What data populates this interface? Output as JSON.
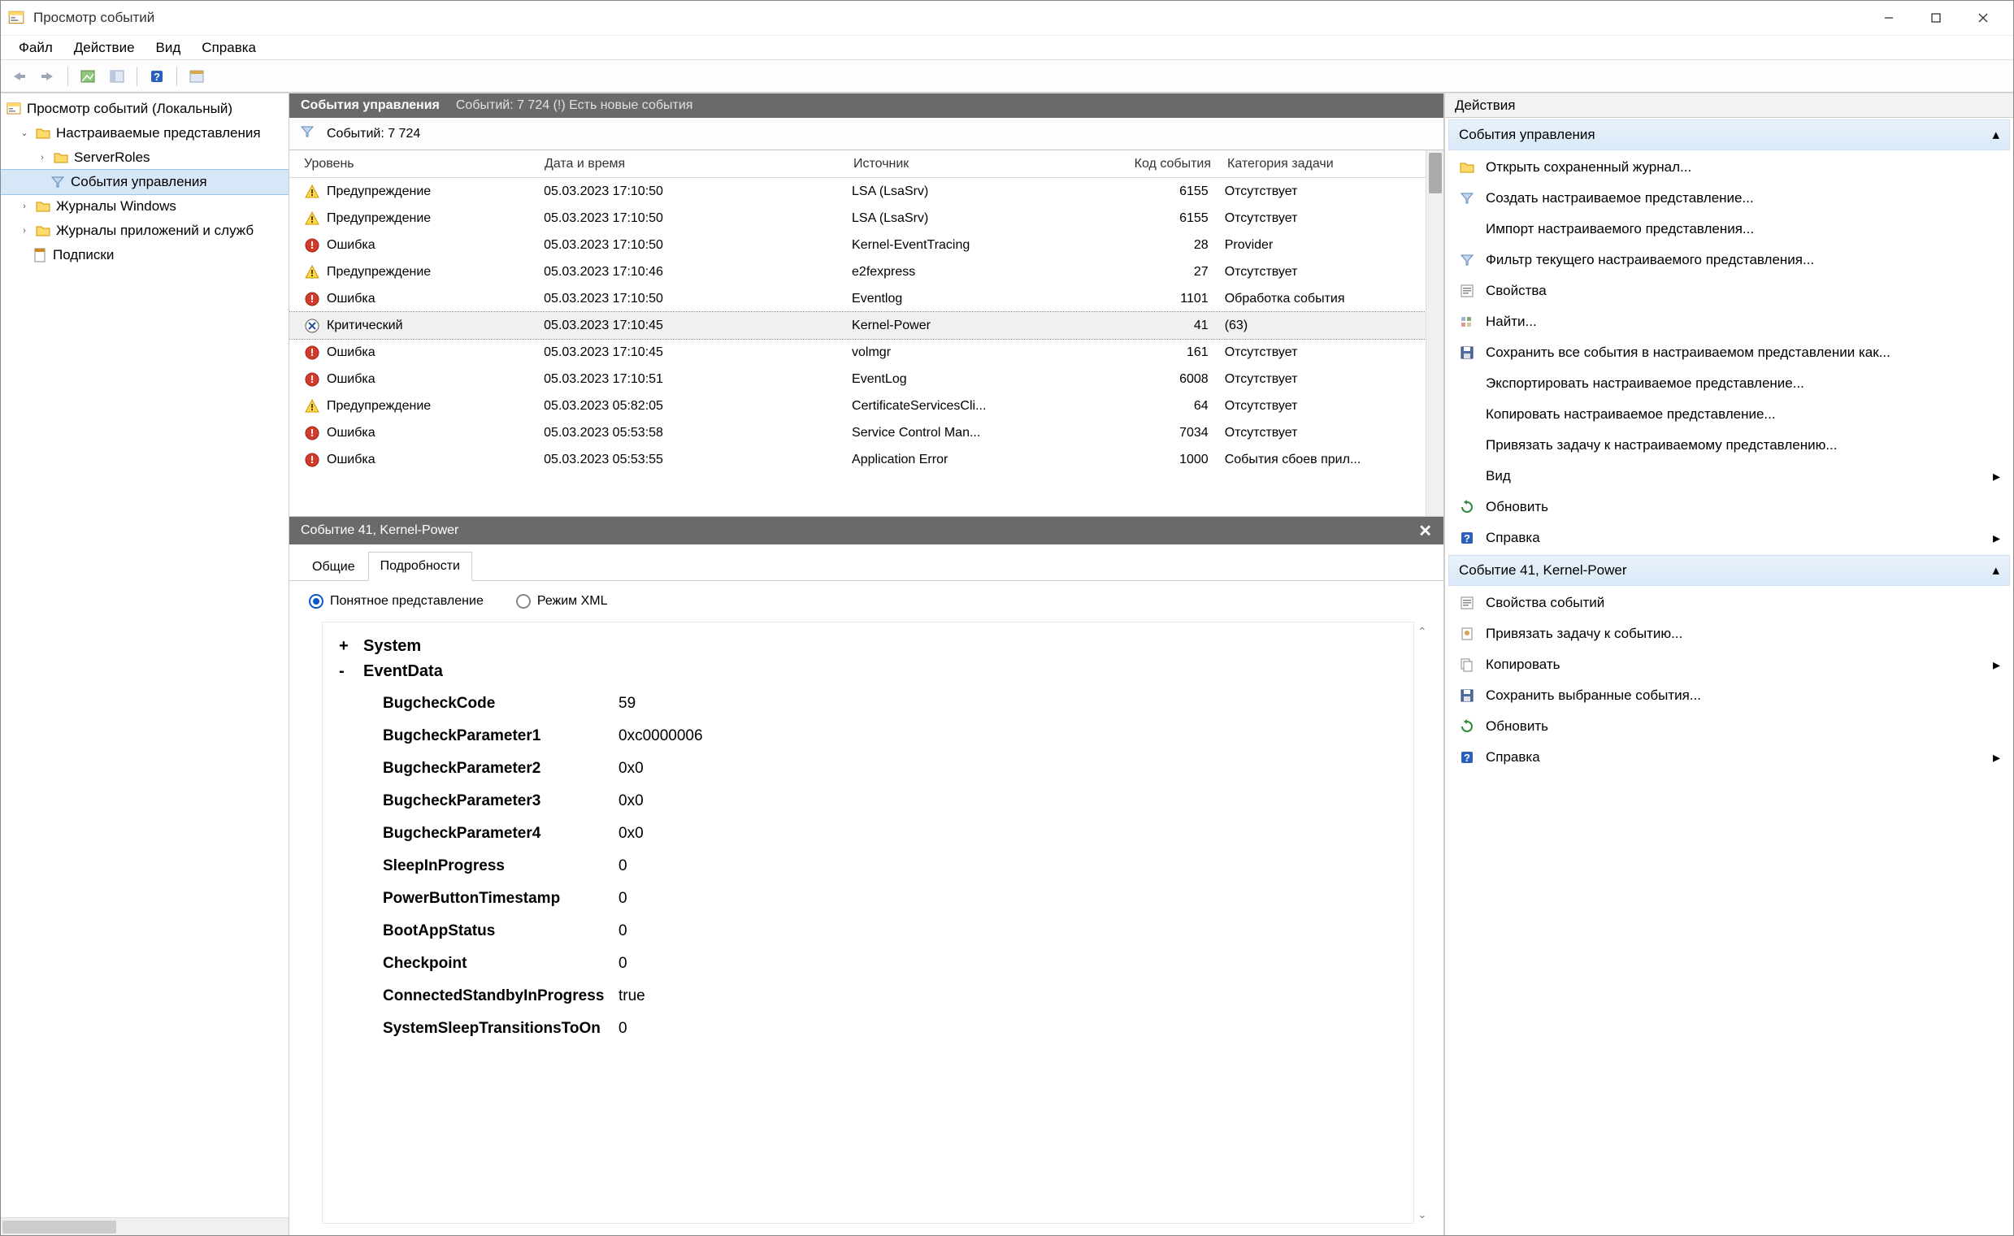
{
  "window": {
    "title": "Просмотр событий"
  },
  "menu": [
    "Файл",
    "Действие",
    "Вид",
    "Справка"
  ],
  "tree": {
    "root": "Просмотр событий (Локальный)",
    "custom_views": "Настраиваемые представления",
    "server_roles": "ServerRoles",
    "events_mgmt": "События управления",
    "windows_logs": "Журналы Windows",
    "app_logs": "Журналы приложений и служб",
    "subscriptions": "Подписки"
  },
  "mid_header": {
    "title": "События управления",
    "sub": "Событий: 7 724 (!) Есть новые события"
  },
  "filter": {
    "count_label": "Событий: 7 724"
  },
  "columns": {
    "level": "Уровень",
    "date": "Дата и время",
    "source": "Источник",
    "id": "Код события",
    "task": "Категория задачи"
  },
  "rows": [
    {
      "lvl": "warn",
      "level": "Предупреждение",
      "date": "05.03.2023 17:10:50",
      "source": "LSA (LsaSrv)",
      "id": "6155",
      "task": "Отсутствует"
    },
    {
      "lvl": "warn",
      "level": "Предупреждение",
      "date": "05.03.2023 17:10:50",
      "source": "LSA (LsaSrv)",
      "id": "6155",
      "task": "Отсутствует"
    },
    {
      "lvl": "err",
      "level": "Ошибка",
      "date": "05.03.2023 17:10:50",
      "source": "Kernel-EventTracing",
      "id": "28",
      "task": "Provider"
    },
    {
      "lvl": "warn",
      "level": "Предупреждение",
      "date": "05.03.2023 17:10:46",
      "source": "e2fexpress",
      "id": "27",
      "task": "Отсутствует"
    },
    {
      "lvl": "err",
      "level": "Ошибка",
      "date": "05.03.2023 17:10:50",
      "source": "Eventlog",
      "id": "1101",
      "task": "Обработка события"
    },
    {
      "lvl": "crit",
      "level": "Критический",
      "date": "05.03.2023 17:10:45",
      "source": "Kernel-Power",
      "id": "41",
      "task": "(63)",
      "sel": true
    },
    {
      "lvl": "err",
      "level": "Ошибка",
      "date": "05.03.2023 17:10:45",
      "source": "volmgr",
      "id": "161",
      "task": "Отсутствует"
    },
    {
      "lvl": "err",
      "level": "Ошибка",
      "date": "05.03.2023 17:10:51",
      "source": "EventLog",
      "id": "6008",
      "task": "Отсутствует"
    },
    {
      "lvl": "warn",
      "level": "Предупреждение",
      "date": "05.03.2023 05:82:05",
      "source": "CertificateServicesCli...",
      "id": "64",
      "task": "Отсутствует"
    },
    {
      "lvl": "err",
      "level": "Ошибка",
      "date": "05.03.2023 05:53:58",
      "source": "Service Control Man...",
      "id": "7034",
      "task": "Отсутствует"
    },
    {
      "lvl": "err",
      "level": "Ошибка",
      "date": "05.03.2023 05:53:55",
      "source": "Application Error",
      "id": "1000",
      "task": "События сбоев прил..."
    }
  ],
  "detail": {
    "title": "Событие 41, Kernel-Power",
    "tabs": {
      "general": "Общие",
      "details": "Подробности"
    },
    "radio": {
      "friendly": "Понятное представление",
      "xml": "Режим XML"
    },
    "system_label": "System",
    "eventdata_label": "EventData",
    "data": [
      {
        "k": "BugcheckCode",
        "v": "59"
      },
      {
        "k": "BugcheckParameter1",
        "v": "0xc0000006"
      },
      {
        "k": "BugcheckParameter2",
        "v": "0x0"
      },
      {
        "k": "BugcheckParameter3",
        "v": "0x0"
      },
      {
        "k": "BugcheckParameter4",
        "v": "0x0"
      },
      {
        "k": "SleepInProgress",
        "v": "0"
      },
      {
        "k": "PowerButtonTimestamp",
        "v": "0"
      },
      {
        "k": "BootAppStatus",
        "v": "0"
      },
      {
        "k": "Checkpoint",
        "v": "0"
      },
      {
        "k": "ConnectedStandbyInProgress",
        "v": "true"
      },
      {
        "k": "SystemSleepTransitionsToOn",
        "v": "0"
      }
    ]
  },
  "actions": {
    "header": "Действия",
    "sec1_title": "События управления",
    "sec1": [
      {
        "icon": "folder",
        "label": "Открыть сохраненный журнал..."
      },
      {
        "icon": "filter",
        "label": "Создать настраиваемое представление..."
      },
      {
        "icon": "",
        "label": "Импорт настраиваемого представления..."
      },
      {
        "icon": "filter",
        "label": "Фильтр текущего настраиваемого представления..."
      },
      {
        "icon": "props",
        "label": "Свойства"
      },
      {
        "icon": "find",
        "label": "Найти..."
      },
      {
        "icon": "save",
        "label": "Сохранить все события в настраиваемом представлении как..."
      },
      {
        "icon": "",
        "label": "Экспортировать настраиваемое представление..."
      },
      {
        "icon": "",
        "label": "Копировать настраиваемое представление..."
      },
      {
        "icon": "",
        "label": "Привязать задачу к настраиваемому представлению..."
      },
      {
        "icon": "",
        "label": "Вид",
        "arrow": true
      },
      {
        "icon": "refresh",
        "label": "Обновить"
      },
      {
        "icon": "help",
        "label": "Справка",
        "arrow": true
      }
    ],
    "sec2_title": "Событие 41, Kernel-Power",
    "sec2": [
      {
        "icon": "props",
        "label": "Свойства событий"
      },
      {
        "icon": "task",
        "label": "Привязать задачу к событию..."
      },
      {
        "icon": "copy",
        "label": "Копировать",
        "arrow": true
      },
      {
        "icon": "save",
        "label": "Сохранить выбранные события..."
      },
      {
        "icon": "refresh",
        "label": "Обновить"
      },
      {
        "icon": "help",
        "label": "Справка",
        "arrow": true
      }
    ]
  }
}
